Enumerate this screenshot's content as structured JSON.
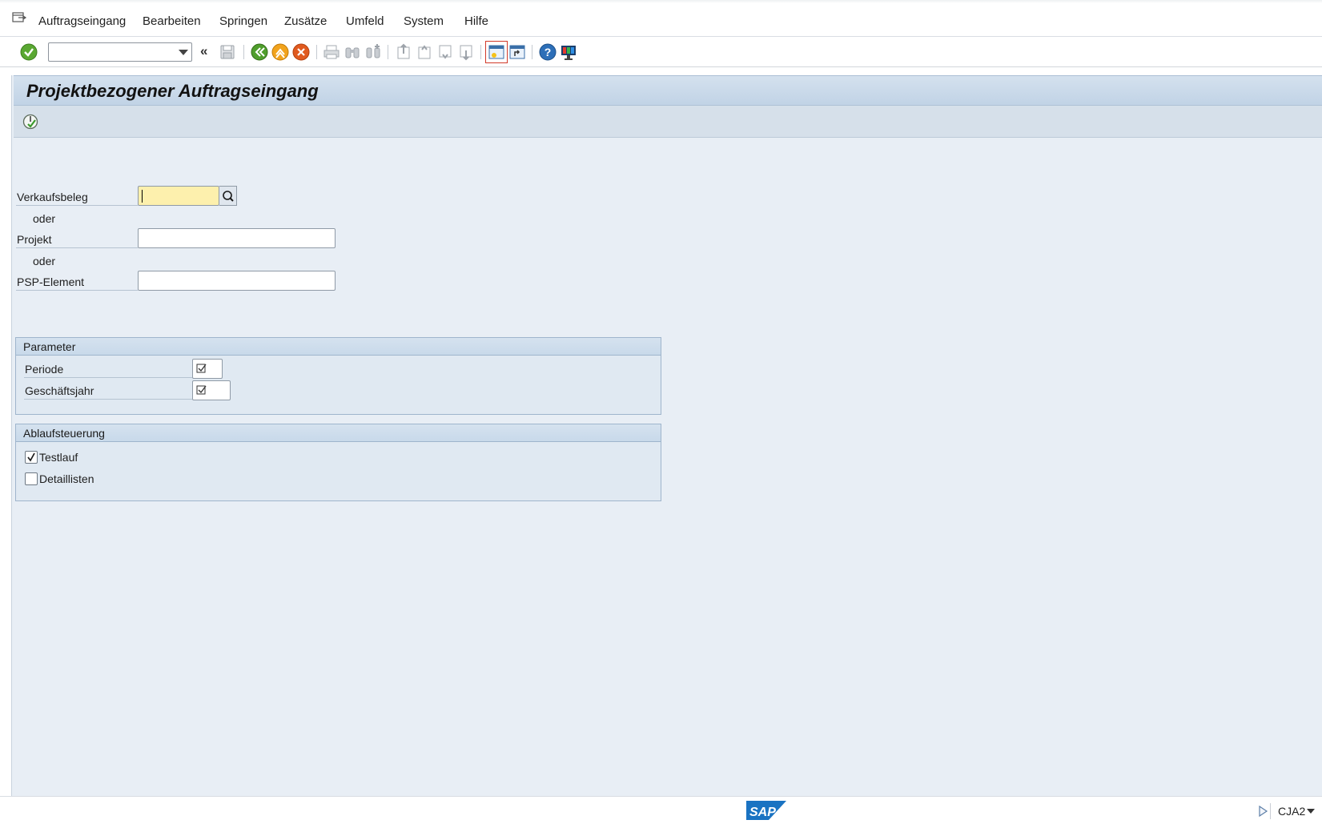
{
  "menu": {
    "items": [
      {
        "label": "Auftragseingang"
      },
      {
        "label": "Bearbeiten"
      },
      {
        "label": "Springen"
      },
      {
        "label": "Zusätze"
      },
      {
        "label": "Umfeld"
      },
      {
        "label": "System"
      },
      {
        "label": "Hilfe"
      }
    ]
  },
  "toolbar": {
    "command_field_value": "",
    "back_chevrons": "«"
  },
  "page": {
    "title": "Projektbezogener Auftragseingang"
  },
  "form": {
    "verkaufsbeleg_label": "Verkaufsbeleg",
    "verkaufsbeleg_value": "",
    "oder1": "oder",
    "projekt_label": "Projekt",
    "projekt_value": "",
    "oder2": "oder",
    "psp_label": "PSP-Element",
    "psp_value": ""
  },
  "parameter": {
    "title": "Parameter",
    "periode_label": "Periode",
    "periode_required": true,
    "geschaeftsjahr_label": "Geschäftsjahr",
    "geschaeftsjahr_required": true
  },
  "ablauf": {
    "title": "Ablaufsteuerung",
    "testlauf_label": "Testlauf",
    "testlauf_checked": true,
    "detaillisten_label": "Detaillisten",
    "detaillisten_checked": false
  },
  "status": {
    "logo_text": "SAP",
    "transaction_code": "CJA2"
  },
  "colors": {
    "content_bg": "#e8eef5",
    "title_bar": "#c1d3e6",
    "focused_field": "#fdf0ad",
    "sap_blue": "#1a73c2"
  }
}
